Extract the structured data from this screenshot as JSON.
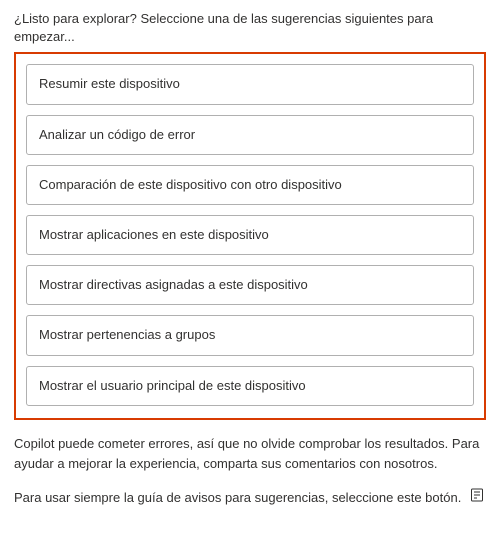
{
  "header": {
    "intro": "¿Listo para explorar? Seleccione una de las sugerencias siguientes para empezar..."
  },
  "suggestions": [
    {
      "label": "Resumir este dispositivo"
    },
    {
      "label": "Analizar un código de error"
    },
    {
      "label": "Comparación de este dispositivo con otro dispositivo"
    },
    {
      "label": "Mostrar aplicaciones en este dispositivo"
    },
    {
      "label": "Mostrar directivas asignadas a este dispositivo"
    },
    {
      "label": "Mostrar pertenencias a grupos"
    },
    {
      "label": "Mostrar el usuario principal de este dispositivo"
    }
  ],
  "footer": {
    "disclaimer": "Copilot puede cometer errores, así que no olvide comprobar los resultados. Para ayudar a mejorar la experiencia, comparta sus comentarios con nosotros.",
    "guide_text": "Para usar siempre la guía de avisos para sugerencias, seleccione este botón.",
    "icon_name": "prompt-guide-icon"
  },
  "colors": {
    "highlight_border": "#d83b01",
    "item_border": "#b0b0b0",
    "text": "#323130"
  }
}
